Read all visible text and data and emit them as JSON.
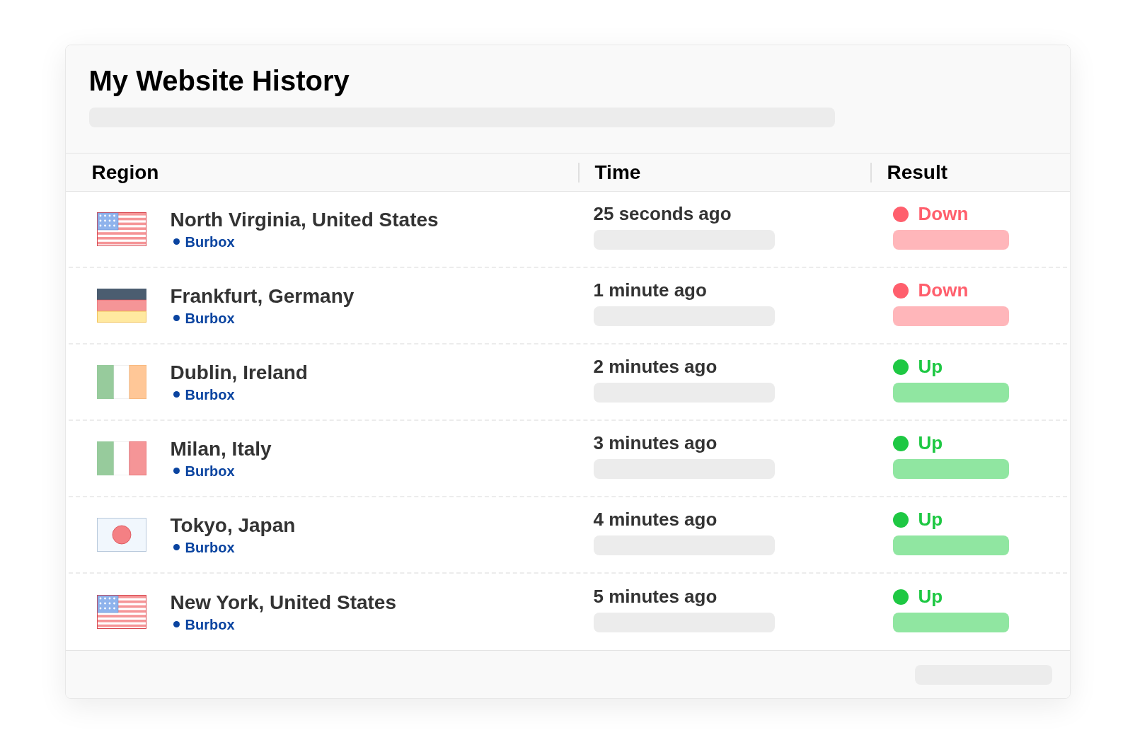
{
  "title": "My Website History",
  "table": {
    "columns": [
      "Region",
      "Time",
      "Result"
    ],
    "rows": [
      {
        "flag": {
          "kind": "us"
        },
        "region": "North Virginia, United States",
        "provider": "Burbox",
        "time": "25 seconds ago",
        "result": {
          "kind": "down",
          "label": "Down",
          "color": "#ff5f6d"
        }
      },
      {
        "flag": {
          "kind": "de"
        },
        "region": "Frankfurt, Germany",
        "provider": "Burbox",
        "time": "1 minute ago",
        "result": {
          "kind": "down",
          "label": "Down",
          "color": "#ff5f6d"
        }
      },
      {
        "flag": {
          "kind": "ie"
        },
        "region": "Dublin, Ireland",
        "provider": "Burbox",
        "time": "2 minutes ago",
        "result": {
          "kind": "up",
          "label": "Up",
          "color": "#1ec843"
        }
      },
      {
        "flag": {
          "kind": "it"
        },
        "region": "Milan, Italy",
        "provider": "Burbox",
        "time": "3 minutes ago",
        "result": {
          "kind": "up",
          "label": "Up",
          "color": "#1ec843"
        }
      },
      {
        "flag": {
          "kind": "jp"
        },
        "region": "Tokyo, Japan",
        "provider": "Burbox",
        "time": "4 minutes ago",
        "result": {
          "kind": "up",
          "label": "Up",
          "color": "#1ec843"
        }
      },
      {
        "flag": {
          "kind": "us"
        },
        "region": "New York, United States",
        "provider": "Burbox",
        "time": "5 minutes ago",
        "result": {
          "kind": "up",
          "label": "Up",
          "color": "#1ec843"
        }
      }
    ]
  }
}
